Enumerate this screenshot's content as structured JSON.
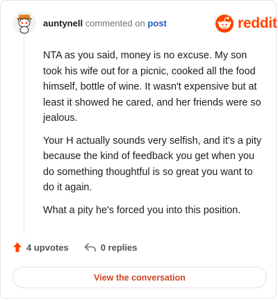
{
  "comment": {
    "username": "auntynell",
    "action_text": "commented on",
    "post_link": "post",
    "brand": "reddit",
    "paragraphs": [
      "NTA as you said, money is no excuse. My son took his wife out for a picnic, cooked all the food himself, bottle of wine. It wasn't expensive but at least it showed he cared, and her friends were so jealous.",
      "Your H actually sounds very selfish, and it's a pity because the kind of feedback you get when you do something thoughtful is so great you want to do it again.",
      "What a pity he's forced you into this position."
    ],
    "upvotes": "4 upvotes",
    "replies": "0 replies",
    "cta": "View the conversation"
  },
  "colors": {
    "brand": "#ff4500",
    "link": "#1c5bbd",
    "cta_text": "#d2431f",
    "upvote_arrow": "#ff4500"
  },
  "icons": {
    "avatar": "snoo-avatar-icon",
    "brand": "reddit-logo-icon",
    "upvote": "upvote-arrow-icon",
    "reply": "reply-arrow-icon"
  }
}
